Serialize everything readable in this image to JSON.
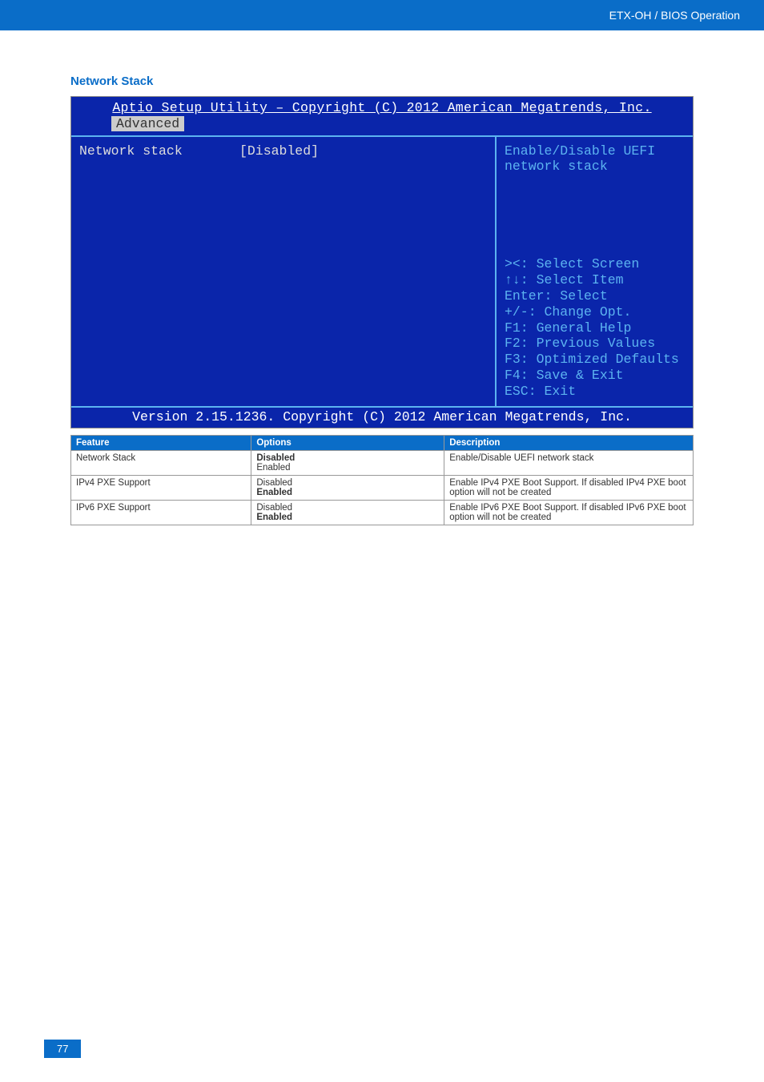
{
  "header": {
    "breadcrumb": "ETX-OH / BIOS Operation"
  },
  "section": {
    "title": "Network Stack"
  },
  "bios": {
    "title": "Aptio Setup Utility – Copyright (C) 2012 American Megatrends, Inc.",
    "tab": "Advanced",
    "item_label": "Network stack",
    "item_value": "[Disabled]",
    "help_top_line1": "Enable/Disable UEFI",
    "help_top_line2": "network stack",
    "keys": {
      "k1": "><: Select Screen",
      "k2": "↑↓: Select Item",
      "k3": "Enter: Select",
      "k4": "+/-: Change Opt.",
      "k5": "F1: General Help",
      "k6": "F2: Previous Values",
      "k7": "F3: Optimized Defaults",
      "k8": "F4: Save & Exit",
      "k9": "ESC: Exit"
    },
    "footer": "Version 2.15.1236. Copyright (C) 2012 American Megatrends, Inc."
  },
  "table": {
    "headers": {
      "feature": "Feature",
      "options": "Options",
      "description": "Description"
    },
    "rows": [
      {
        "feature": "Network Stack",
        "opt1": "Disabled",
        "opt1_bold": true,
        "opt2": "Enabled",
        "opt2_bold": false,
        "description": "Enable/Disable UEFI network stack"
      },
      {
        "feature": "IPv4 PXE Support",
        "opt1": "Disabled",
        "opt1_bold": false,
        "opt2": "Enabled",
        "opt2_bold": true,
        "description": "Enable IPv4 PXE Boot Support. If disabled IPv4 PXE boot option will not be created"
      },
      {
        "feature": "IPv6 PXE Support",
        "opt1": "Disabled",
        "opt1_bold": false,
        "opt2": "Enabled",
        "opt2_bold": true,
        "description": "Enable IPv6 PXE Boot Support. If disabled IPv6 PXE boot option will not be created"
      }
    ]
  },
  "page_number": "77"
}
